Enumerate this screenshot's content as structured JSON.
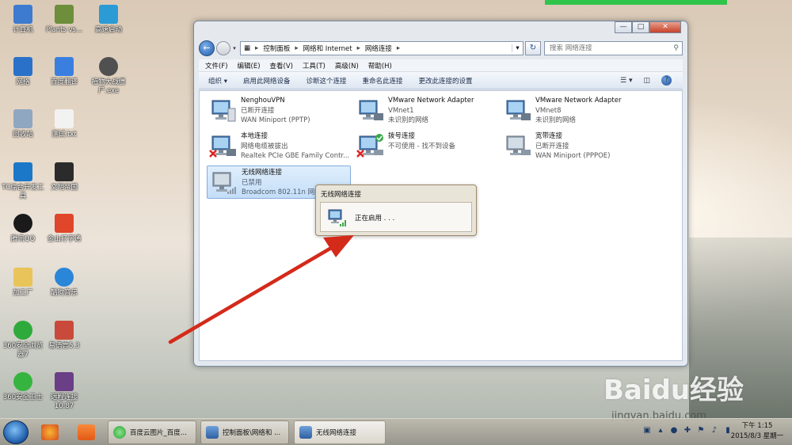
{
  "desktop": {
    "icons": [
      {
        "label": "计算机",
        "color": "#3d7bd0"
      },
      {
        "label": "Plants vs...",
        "color": "#6d8e3a"
      },
      {
        "label": "高速启动",
        "color": "#2b9bd6"
      },
      {
        "label": "网络",
        "color": "#2a71c9"
      },
      {
        "label": "百度翻译",
        "color": "#3a7fe0"
      },
      {
        "label": "植物大战僵尸.exe",
        "color": "#505050"
      },
      {
        "label": "回收站",
        "color": "#8fa7c0"
      },
      {
        "label": "测试.txt",
        "color": "#f2f2f2"
      },
      {
        "label": "TC综合开发工具",
        "color": "#1b77c8"
      },
      {
        "label": "文明帝国",
        "color": "#2b2b2b"
      },
      {
        "label": "腾讯QQ",
        "color": "#1a1a1a"
      },
      {
        "label": "金山打字通",
        "color": "#e0462a"
      },
      {
        "label": "加工厂",
        "color": "#e9c45a"
      },
      {
        "label": "酷狗音乐",
        "color": "#2a86d8"
      },
      {
        "label": "360安全浏览器7",
        "color": "#2eaa3c"
      },
      {
        "label": "易语言5.3",
        "color": "#c94a3a"
      },
      {
        "label": "360安全卫士",
        "color": "#35b53f"
      },
      {
        "label": "远程连接10.87",
        "color": "#6a3f86"
      }
    ]
  },
  "window": {
    "address": {
      "crumbs": [
        "控制面板",
        "网络和 Internet",
        "网络连接"
      ]
    },
    "search": {
      "placeholder": "搜索 网络连接"
    },
    "menu": [
      "文件(F)",
      "编辑(E)",
      "查看(V)",
      "工具(T)",
      "高级(N)",
      "帮助(H)"
    ],
    "commands": [
      "组织 ▾",
      "启用此网络设备",
      "诊断这个连接",
      "重命名此连接",
      "更改此连接的设置"
    ],
    "connections": [
      {
        "name": "NenghouVPN",
        "status": "已断开连接",
        "device": "WAN Miniport (PPTP)"
      },
      {
        "name": "VMware Network Adapter",
        "status": "VMnet1",
        "device": "未识别的网络"
      },
      {
        "name": "VMware Network Adapter",
        "status": "VMnet8",
        "device": "未识别的网络"
      },
      {
        "name": "本地连接",
        "status": "网络电缆被拔出",
        "device": "Realtek PCIe GBE Family Contr..."
      },
      {
        "name": "拨号连接",
        "status": "不可使用 - 找不到设备",
        "device": ""
      },
      {
        "name": "宽带连接",
        "status": "已断开连接",
        "device": "WAN Miniport (PPPOE)"
      },
      {
        "name": "无线网络连接",
        "status": "已禁用",
        "device": "Broadcom 802.11n 网络..."
      }
    ]
  },
  "popup": {
    "title": "无线网络连接",
    "status": "正在启用 . . ."
  },
  "taskbar": {
    "buttons": [
      "百度云图片_百度...",
      "控制面板\\网络和 ...",
      "无线网络连接"
    ],
    "clock_time": "下午 1:15",
    "clock_date": "2015/8/3 星期一"
  },
  "watermark": {
    "logo": "Baidu经验",
    "url": "jingyan.baidu.com"
  },
  "colors": {
    "arrow": "#d42a1a",
    "selection": "#c4def8",
    "accent": "#1e5cad"
  }
}
